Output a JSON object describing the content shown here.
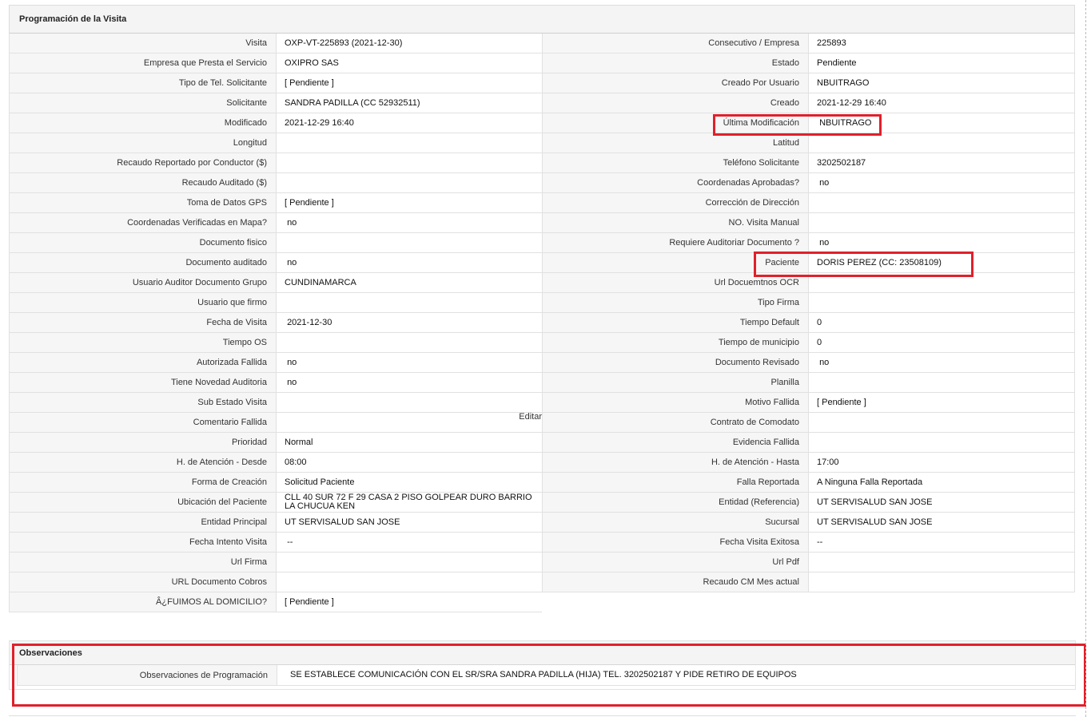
{
  "panel": {
    "title": "Programación de la Visita"
  },
  "left": [
    {
      "label": "Visita",
      "value": "OXP-VT-225893 (2021-12-30)"
    },
    {
      "label": "Empresa que Presta el Servicio",
      "value": "OXIPRO SAS"
    },
    {
      "label": "Tipo de Tel. Solicitante",
      "value": "[ Pendiente ]"
    },
    {
      "label": "Solicitante",
      "value": "SANDRA PADILLA (CC 52932511)"
    },
    {
      "label": "Modificado",
      "value": "2021-12-29 16:40"
    },
    {
      "label": "Longitud",
      "value": ""
    },
    {
      "label": "Recaudo Reportado por Conductor ($)",
      "value": ""
    },
    {
      "label": "Recaudo Auditado ($)",
      "value": ""
    },
    {
      "label": "Toma de Datos GPS",
      "value": "[ Pendiente ]"
    },
    {
      "label": "Coordenadas Verificadas en Mapa?",
      "value": " no"
    },
    {
      "label": "Documento fisico",
      "value": ""
    },
    {
      "label": "Documento auditado",
      "value": " no"
    },
    {
      "label": "Usuario Auditor Documento Grupo",
      "value": "CUNDINAMARCA"
    },
    {
      "label": "Usuario que firmo",
      "value": ""
    },
    {
      "label": "Fecha de Visita",
      "value": " 2021-12-30"
    },
    {
      "label": "Tiempo OS",
      "value": ""
    },
    {
      "label": "Autorizada Fallida",
      "value": " no"
    },
    {
      "label": "Tiene Novedad Auditoria",
      "value": " no"
    },
    {
      "label": "Sub Estado Visita",
      "value": ""
    },
    {
      "label": "Comentario Fallida",
      "value": "",
      "extra": "Editar"
    },
    {
      "label": "Prioridad",
      "value": "Normal"
    },
    {
      "label": "H. de Atención - Desde",
      "value": "08:00"
    },
    {
      "label": "Forma de Creación",
      "value": "Solicitud Paciente"
    },
    {
      "label": "Ubicación del Paciente",
      "value": "CLL 40 SUR 72 F 29 CASA 2 PISO GOLPEAR DURO BARRIO LA CHUCUA KEN"
    },
    {
      "label": "Entidad Principal",
      "value": "UT SERVISALUD SAN JOSE"
    },
    {
      "label": "Fecha Intento Visita",
      "value": " --"
    },
    {
      "label": "Url Firma",
      "value": ""
    },
    {
      "label": "URL Documento Cobros",
      "value": ""
    },
    {
      "label": "Â¿FUIMOS AL DOMICILIO?",
      "value": "[ Pendiente ]"
    }
  ],
  "right": [
    {
      "label": "Consecutivo / Empresa",
      "value": "225893"
    },
    {
      "label": "Estado",
      "value": "Pendiente"
    },
    {
      "label": "Creado Por Usuario",
      "value": "NBUITRAGO"
    },
    {
      "label": "Creado",
      "value": "2021-12-29 16:40"
    },
    {
      "label": "Última Modificación",
      "value": " NBUITRAGO"
    },
    {
      "label": "Latitud",
      "value": ""
    },
    {
      "label": "Teléfono Solicitante",
      "value": "3202502187"
    },
    {
      "label": "Coordenadas Aprobadas?",
      "value": " no"
    },
    {
      "label": "Corrección de Dirección",
      "value": ""
    },
    {
      "label": "NO. Visita Manual",
      "value": ""
    },
    {
      "label": "Requiere Auditoriar Documento ?",
      "value": " no"
    },
    {
      "label": "Paciente",
      "value": "DORIS PEREZ (CC: 23508109)"
    },
    {
      "label": "Url Docuemtnos OCR",
      "value": ""
    },
    {
      "label": "Tipo Firma",
      "value": ""
    },
    {
      "label": "Tiempo Default",
      "value": "0"
    },
    {
      "label": "Tiempo de municipio",
      "value": "0"
    },
    {
      "label": "Documento Revisado",
      "value": " no"
    },
    {
      "label": "Planilla",
      "value": ""
    },
    {
      "label": "Motivo Fallida",
      "value": "[ Pendiente ]"
    },
    {
      "label": "Contrato de Comodato",
      "value": ""
    },
    {
      "label": "Evidencia Fallida",
      "value": ""
    },
    {
      "label": "H. de Atención - Hasta",
      "value": "17:00"
    },
    {
      "label": "Falla Reportada",
      "value": "A Ninguna Falla Reportada"
    },
    {
      "label": "Entidad (Referencia)",
      "value": "UT SERVISALUD SAN JOSE"
    },
    {
      "label": "Sucursal",
      "value": "UT SERVISALUD SAN JOSE"
    },
    {
      "label": "Fecha Visita Exitosa",
      "value": "--"
    },
    {
      "label": "Url Pdf",
      "value": ""
    },
    {
      "label": "Recaudo CM Mes actual",
      "value": ""
    }
  ],
  "observaciones": {
    "title": "Observaciones",
    "label": "Observaciones de Programación",
    "value": "SE ESTABLECE COMUNICACIÓN CON EL SR/SRA SANDRA PADILLA (HIJA) TEL. 3202502187 Y PIDE RETIRO DE EQUIPOS"
  },
  "colors": {
    "highlight": "#e0202b"
  }
}
